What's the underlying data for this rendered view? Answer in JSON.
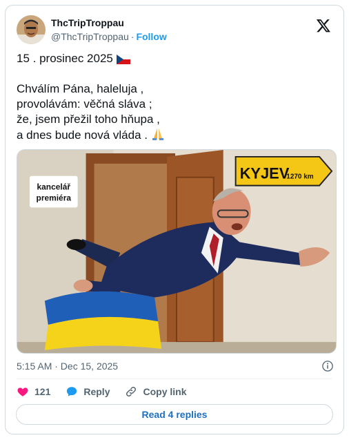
{
  "author": {
    "display_name": "ThcTripTroppau",
    "handle": "@ThcTripTroppau",
    "separator": "·",
    "follow_label": "Follow"
  },
  "tweet": {
    "text": "15 . prosinec 2025 \n\nChválím Pána, haleluja ,\nprovolávám: věčná sláva ;\nže, jsem přežil toho hňupa ,\na dnes bude nová vláda . ",
    "line1": "15 . prosinec 2025",
    "line2": "Chválím Pána, haleluja ,",
    "line3": "provolávám: věčná sláva ;",
    "line4": "že, jsem přežil toho hňupa ,",
    "line5": "a dnes bude nová vláda ."
  },
  "media": {
    "sign_office": "kancelář\npremiéra",
    "sign_office_line1": "kancelář",
    "sign_office_line2": "premiéra",
    "sign_direction": "KYJEV",
    "sign_distance": "1270 km"
  },
  "meta": {
    "timestamp": "5:15 AM · Dec 15, 2025"
  },
  "actions": {
    "like_count": "121",
    "reply_label": "Reply",
    "copy_link_label": "Copy link"
  },
  "footer": {
    "read_replies_label": "Read 4 replies"
  },
  "icons": {
    "logo": "x-logo-icon",
    "heart": "heart-icon",
    "reply": "reply-bubble-icon",
    "link": "link-icon",
    "info": "info-icon",
    "flag": "czech-flag-icon",
    "pray": "praying-hands-icon"
  },
  "colors": {
    "accent": "#1d9bf0",
    "like": "#f91880",
    "text_secondary": "#536471"
  }
}
